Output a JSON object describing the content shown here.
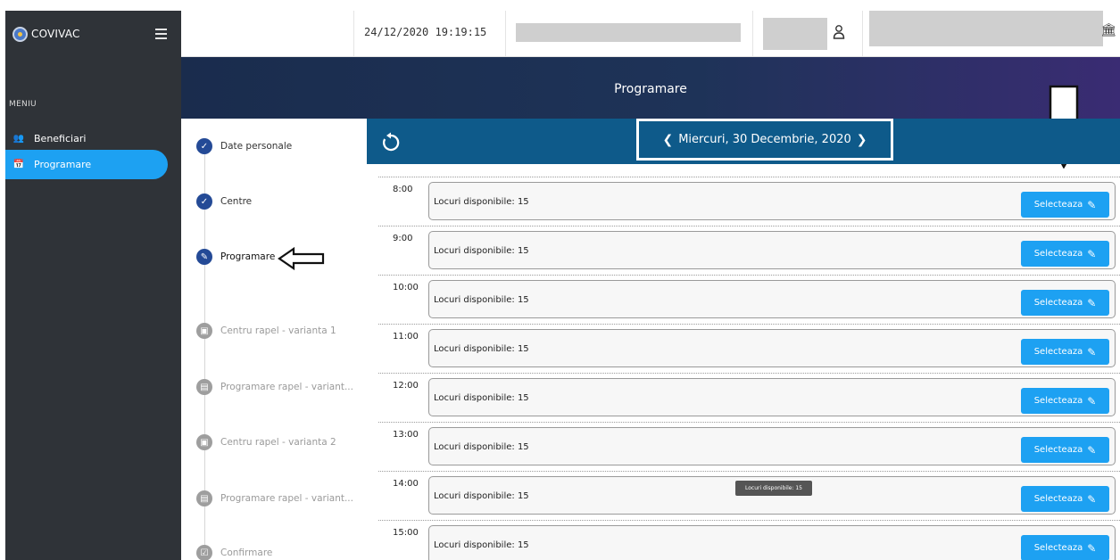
{
  "app": {
    "name": "COVIVAC"
  },
  "sidebar": {
    "menu_title": "MENIU",
    "items": [
      {
        "label": "Beneficiari",
        "icon": "users-icon",
        "active": false
      },
      {
        "label": "Programare",
        "icon": "calendar-icon",
        "active": true
      }
    ]
  },
  "topbar": {
    "datetime": "24/12/2020 19:19:15"
  },
  "page": {
    "title": "Programare"
  },
  "steps": [
    {
      "label": "Date personale",
      "state": "done",
      "icon": "check-icon"
    },
    {
      "label": "Centre",
      "state": "done",
      "icon": "check-icon"
    },
    {
      "label": "Programare",
      "state": "current",
      "icon": "pencil-icon"
    },
    {
      "label": "Centru rapel - varianta 1",
      "state": "pending",
      "icon": "building-icon"
    },
    {
      "label": "Programare rapel - variant...",
      "state": "pending",
      "icon": "calendar-icon"
    },
    {
      "label": "Centru rapel - varianta 2",
      "state": "pending",
      "icon": "building-icon"
    },
    {
      "label": "Programare rapel - variant...",
      "state": "pending",
      "icon": "calendar-icon"
    },
    {
      "label": "Confirmare",
      "state": "pending",
      "icon": "checkbox-icon"
    }
  ],
  "date_nav": {
    "prev": "❮",
    "date": "Miercuri, 30 Decembrie, 2020",
    "next": "❯"
  },
  "slots": [
    {
      "time": "8:00",
      "text": "Locuri disponibile: 15",
      "button": "Selecteaza"
    },
    {
      "time": "9:00",
      "text": "Locuri disponibile: 15",
      "button": "Selecteaza"
    },
    {
      "time": "10:00",
      "text": "Locuri disponibile: 15",
      "button": "Selecteaza"
    },
    {
      "time": "11:00",
      "text": "Locuri disponibile: 15",
      "button": "Selecteaza"
    },
    {
      "time": "12:00",
      "text": "Locuri disponibile: 15",
      "button": "Selecteaza"
    },
    {
      "time": "13:00",
      "text": "Locuri disponibile: 15",
      "button": "Selecteaza"
    },
    {
      "time": "14:00",
      "text": "Locuri disponibile: 15",
      "button": "Selecteaza"
    },
    {
      "time": "15:00",
      "text": "Locuri disponibile: 15",
      "button": "Selecteaza"
    }
  ],
  "tooltip": {
    "text": "Locuri disponibile: 15"
  },
  "colors": {
    "sidebar_bg": "#2f3338",
    "accent_blue": "#1da1f2",
    "header_band": "#1a2c4d",
    "date_bar": "#0e5a8a",
    "step_done": "#244a96",
    "step_pending": "#9e9e9e"
  }
}
